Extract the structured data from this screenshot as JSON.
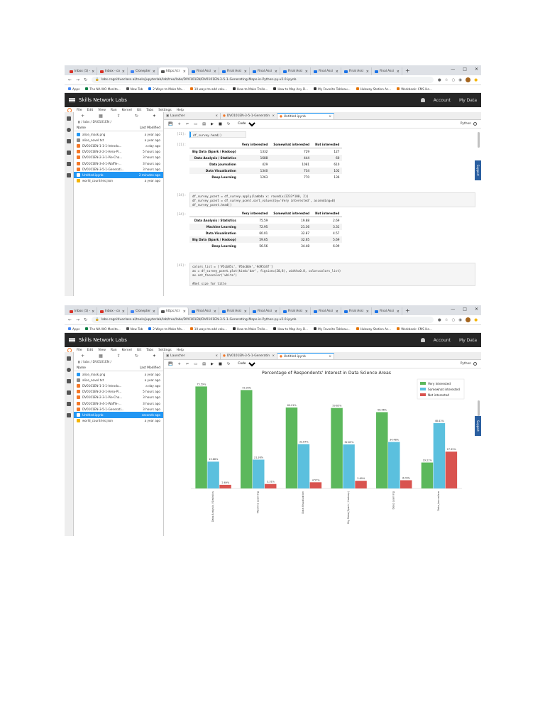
{
  "browser": {
    "tabs": [
      {
        "label": "Inbox (1) -",
        "color": "#d93025"
      },
      {
        "label": "Inbox - co",
        "color": "#d93025"
      },
      {
        "label": "Clonepter",
        "color": "#4285f4"
      },
      {
        "label": "https://cr",
        "color": "#555555",
        "active": true
      },
      {
        "label": "Final Assi",
        "color": "#1a73e8"
      },
      {
        "label": "Final Assi",
        "color": "#1a73e8"
      },
      {
        "label": "Final Assi",
        "color": "#1a73e8"
      },
      {
        "label": "Final Assi",
        "color": "#1a73e8"
      },
      {
        "label": "Final Assi",
        "color": "#1a73e8"
      },
      {
        "label": "Final Assi",
        "color": "#1a73e8"
      },
      {
        "label": "Final Assi",
        "color": "#1a73e8"
      }
    ],
    "url": "labs.cognitiveclass.ai/tools/jupyterlab/lab/tree/labs/DV0101EN/DV0101EN-3-5-1-Generating-Maps-in-Python-py-v2.0.ipynb",
    "bookmarks": [
      {
        "label": "Apps",
        "color": "#4285f4"
      },
      {
        "label": "The NA WO Monito...",
        "color": "#0b8043"
      },
      {
        "label": "New Tab",
        "color": "#555555"
      },
      {
        "label": "2 Ways to Make Ma...",
        "color": "#1a73e8"
      },
      {
        "label": "10 ways to add valu...",
        "color": "#e8710a"
      },
      {
        "label": "How to Make Trello...",
        "color": "#333333"
      },
      {
        "label": "How to Map Any D...",
        "color": "#333333"
      },
      {
        "label": "My Favorite Tableau...",
        "color": "#333333"
      },
      {
        "label": "Hubway Station Ac...",
        "color": "#e37400"
      },
      {
        "label": "Workbook: CMS Ho...",
        "color": "#e37400"
      }
    ]
  },
  "header": {
    "brand": "Skills Network Labs",
    "account": "Account",
    "my_data": "My Data"
  },
  "menu": [
    "File",
    "Edit",
    "View",
    "Run",
    "Kernel",
    "Git",
    "Tabs",
    "Settings",
    "Help"
  ],
  "filebrowser": {
    "breadcrumb": "/ labs / DV0101EN /",
    "col_name": "Name",
    "col_modified": "Last Modified",
    "files": [
      {
        "name": "alice_mask.png",
        "color": "#2196f3"
      },
      {
        "name": "alice_novel.txt",
        "color": "#888888"
      },
      {
        "name": "DV0101EN-1-1-1-Introdu...",
        "color": "#f37726"
      },
      {
        "name": "DV0101EN-2-2-1-Area-Pl...",
        "color": "#f37726"
      },
      {
        "name": "DV0101EN-2-3-1-Pie-Cha...",
        "color": "#f37726"
      },
      {
        "name": "DV0101EN-3-4-1-Waffle-...",
        "color": "#f37726"
      },
      {
        "name": "DV0101EN-3-5-1-Generati...",
        "color": "#f37726"
      },
      {
        "name": "Untitled.ipynb",
        "color": "#f37726",
        "selected": true
      },
      {
        "name": "world_countries.json",
        "color": "#f4b400"
      }
    ],
    "modified_1": [
      "a year ago",
      "a year ago",
      "a day ago",
      "5 hours ago",
      "3 hours ago",
      "3 hours ago",
      "3 hours ago",
      "2 minutes ago",
      "a year ago"
    ],
    "modified_2": [
      "a year ago",
      "a year ago",
      "a day ago",
      "5 hours ago",
      "3 hours ago",
      "3 hours ago",
      "3 hours ago",
      "seconds ago",
      "a year ago"
    ]
  },
  "doc_tabs": [
    {
      "label": "Launcher",
      "active": false
    },
    {
      "label": "DV0101EN-3-5-1-Generatin",
      "active": false
    },
    {
      "label": "Untitled.ipynb",
      "active": true
    }
  ],
  "toolbar": {
    "cell_type": "Code",
    "kernel": "Python"
  },
  "support_label": "Support",
  "cells": {
    "prompt_1": "[21]:",
    "code_1": "df_survey.head()",
    "prompt_out_1": "[21]:",
    "prompt_2": "[34]:",
    "code_2": "df_survey_pcent = df_survey.apply(lambda x: round(x/2233*100, 2))\ndf_survey_pcent = df_survey_pcent.sort_values(by='Very interested', ascending=0)\ndf_survey_pcent.head()",
    "prompt_out_2": "[34]:",
    "prompt_3": "[41]:",
    "code_3": "colors_list = ['#5cb85c','#5bc0de','#d9534f']\nax = df_survey_pcent.plot(kind='bar', figsize=(20,8), width=0.8, color=colors_list)\nax.set_facecolor('white')\n\n#Set size for title",
    "table_columns": [
      "Very interested",
      "Somewhat interested",
      "Not interested"
    ],
    "table_1": [
      {
        "idx": "Big Data (Spark / Hadoop)",
        "v": [
          "1332",
          "729",
          "127"
        ]
      },
      {
        "idx": "Data Analysis / Statistics",
        "v": [
          "1688",
          "444",
          "60"
        ]
      },
      {
        "idx": "Data Journalism",
        "v": [
          "429",
          "1081",
          "610"
        ]
      },
      {
        "idx": "Data Visualization",
        "v": [
          "1340",
          "734",
          "102"
        ]
      },
      {
        "idx": "Deep Learning",
        "v": [
          "1263",
          "770",
          "136"
        ]
      }
    ],
    "table_2": [
      {
        "idx": "Data Analysis / Statistics",
        "v": [
          "75.59",
          "19.88",
          "2.69"
        ]
      },
      {
        "idx": "Machine Learning",
        "v": [
          "72.95",
          "21.36",
          "3.31"
        ]
      },
      {
        "idx": "Data Visualization",
        "v": [
          "60.01",
          "32.87",
          "4.57"
        ]
      },
      {
        "idx": "Big Data (Spark / Hadoop)",
        "v": [
          "59.65",
          "32.65",
          "5.69"
        ]
      },
      {
        "idx": "Deep Learning",
        "v": [
          "56.56",
          "34.48",
          "6.09"
        ]
      }
    ]
  },
  "chart_data": {
    "type": "bar",
    "title": "Percentage of Respondents' Interest in Data Science Areas",
    "categories": [
      "Data Analysis / Statistics",
      "Machine Learning",
      "Data Visualization",
      "Big Data (Spark / Hadoop)",
      "Deep Learning",
      "Data Journalism"
    ],
    "series": [
      {
        "name": "Very interested",
        "color": "#5cb85c",
        "values": [
          75.59,
          72.95,
          60.01,
          59.65,
          56.56,
          19.21
        ]
      },
      {
        "name": "Somewhat interested",
        "color": "#5bc0de",
        "values": [
          19.88,
          21.36,
          32.87,
          32.65,
          34.48,
          48.41
        ]
      },
      {
        "name": "Not interested",
        "color": "#d9534f",
        "values": [
          2.69,
          3.31,
          4.57,
          5.69,
          6.09,
          27.32
        ]
      }
    ],
    "value_labels": [
      [
        "75.59%",
        "72.95%",
        "60.01%",
        "59.65%",
        "56.56%",
        "19.21%"
      ],
      [
        "19.88%",
        "21.36%",
        "32.87%",
        "32.65%",
        "34.48%",
        "48.41%"
      ],
      [
        "2.69%",
        "3.31%",
        "4.57%",
        "5.69%",
        "6.09%",
        "27.32%"
      ]
    ],
    "ylim": [
      0,
      80
    ],
    "legend": "top-right",
    "grid": false
  }
}
